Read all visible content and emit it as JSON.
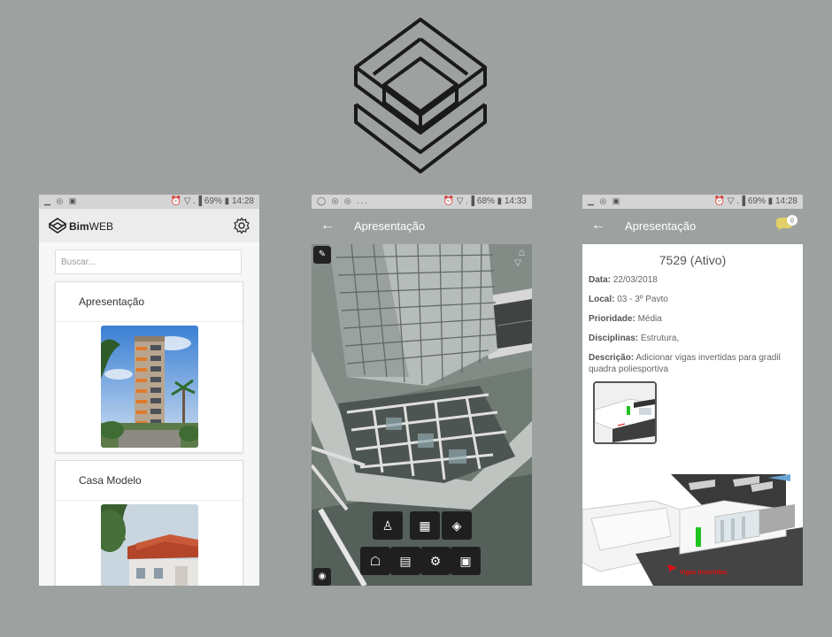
{
  "panels": {
    "list": {
      "status": {
        "left_icons": "▁ ◎ ▣",
        "right_icons": "⏰ ▽ .▐ 69% ▮ 14:28"
      },
      "brand": {
        "strong": "Bim",
        "light": "WEB"
      },
      "search_placeholder": "Buscar...",
      "cards": [
        {
          "title": "Apresentação"
        },
        {
          "title": "Casa Modelo"
        }
      ]
    },
    "viewer": {
      "status": {
        "left_icons": "◯ ◎ ◎ ...",
        "right_icons": "⏰ ▽ .▐ 68% ▮ 14:33"
      },
      "title": "Apresentação",
      "back_icon": "arrow-left-icon"
    },
    "issue": {
      "status": {
        "left_icons": "▁ ◎ ▣",
        "right_icons": "⏰ ▽ .▐ 69% ▮ 14:28"
      },
      "title": "Apresentação",
      "comment_count": "0",
      "issue_title": "7529 (Ativo)",
      "fields": [
        {
          "label": "Data:",
          "value": "22/03/2018"
        },
        {
          "label": "Local:",
          "value": "03 - 3º Pavto"
        },
        {
          "label": "Prioridade:",
          "value": "Média"
        },
        {
          "label": "Disciplinas:",
          "value": "Estrutura,"
        },
        {
          "label": "Descrição:",
          "value": "Adicionar vigas invertidas para gradil quadra poliesportiva"
        }
      ],
      "annotation": "Vigas invertidas"
    }
  }
}
